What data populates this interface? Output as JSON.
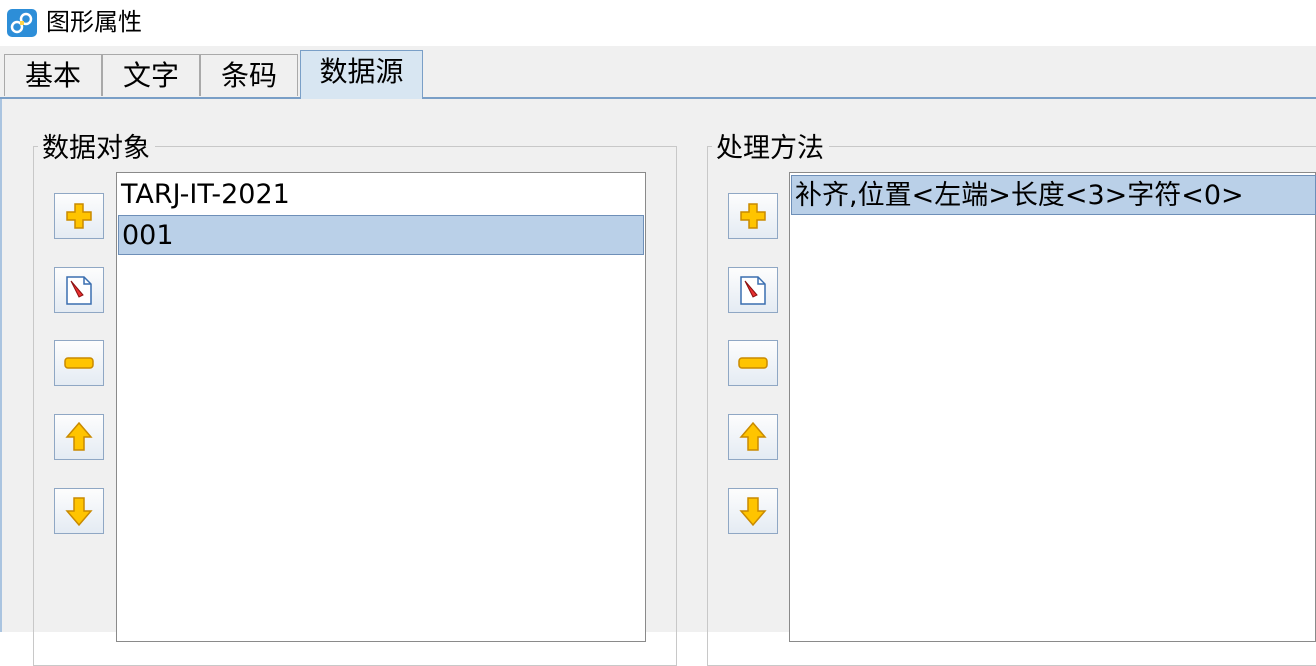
{
  "window": {
    "title": "图形属性",
    "icon": "app-logo-icon"
  },
  "tabs": [
    {
      "label": "基本",
      "active": false
    },
    {
      "label": "文字",
      "active": false
    },
    {
      "label": "条码",
      "active": false
    },
    {
      "label": "数据源",
      "active": true
    }
  ],
  "data_objects": {
    "label": "数据对象",
    "items": [
      {
        "text": "TARJ-IT-2021",
        "selected": false
      },
      {
        "text": "001",
        "selected": true
      }
    ],
    "buttons": [
      "add-icon",
      "edit-icon",
      "remove-icon",
      "move-up-icon",
      "move-down-icon"
    ]
  },
  "processing": {
    "label": "处理方法",
    "items": [
      {
        "text": "补齐,位置<左端>长度<3>字符<0>",
        "selected": true
      }
    ],
    "buttons": [
      "add-icon",
      "edit-icon",
      "remove-icon",
      "move-up-icon",
      "move-down-icon"
    ]
  },
  "colors": {
    "selection": "#bad0e8",
    "active_tab": "#d8e6f2",
    "button_icon": "#f5b800"
  }
}
